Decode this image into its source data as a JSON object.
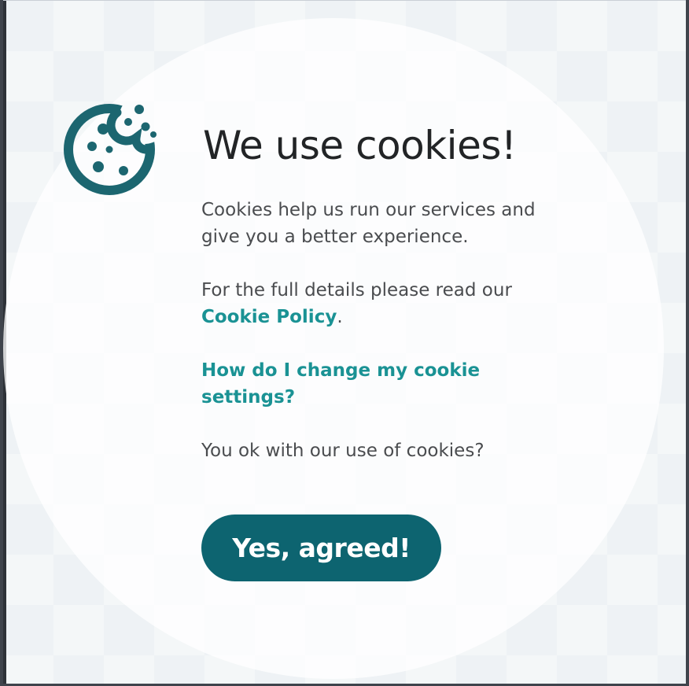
{
  "cookie_banner": {
    "title": "We use cookies!",
    "intro_text": "Cookies help us run our services and give you a better experience.",
    "details_text": "For the full details please read our ",
    "policy_link_label": "Cookie Policy",
    "details_suffix": ".",
    "settings_link_label": "How do I change my cookie settings?",
    "question_text": "You ok with our use of cookies?",
    "agree_button_label": "Yes, agreed!",
    "icon": "cookie-icon",
    "colors": {
      "accent": "#1a9294",
      "button_bg": "#0d6470",
      "icon": "#1c6670",
      "title_text": "#222426",
      "body_text": "#4a4c4f"
    }
  }
}
